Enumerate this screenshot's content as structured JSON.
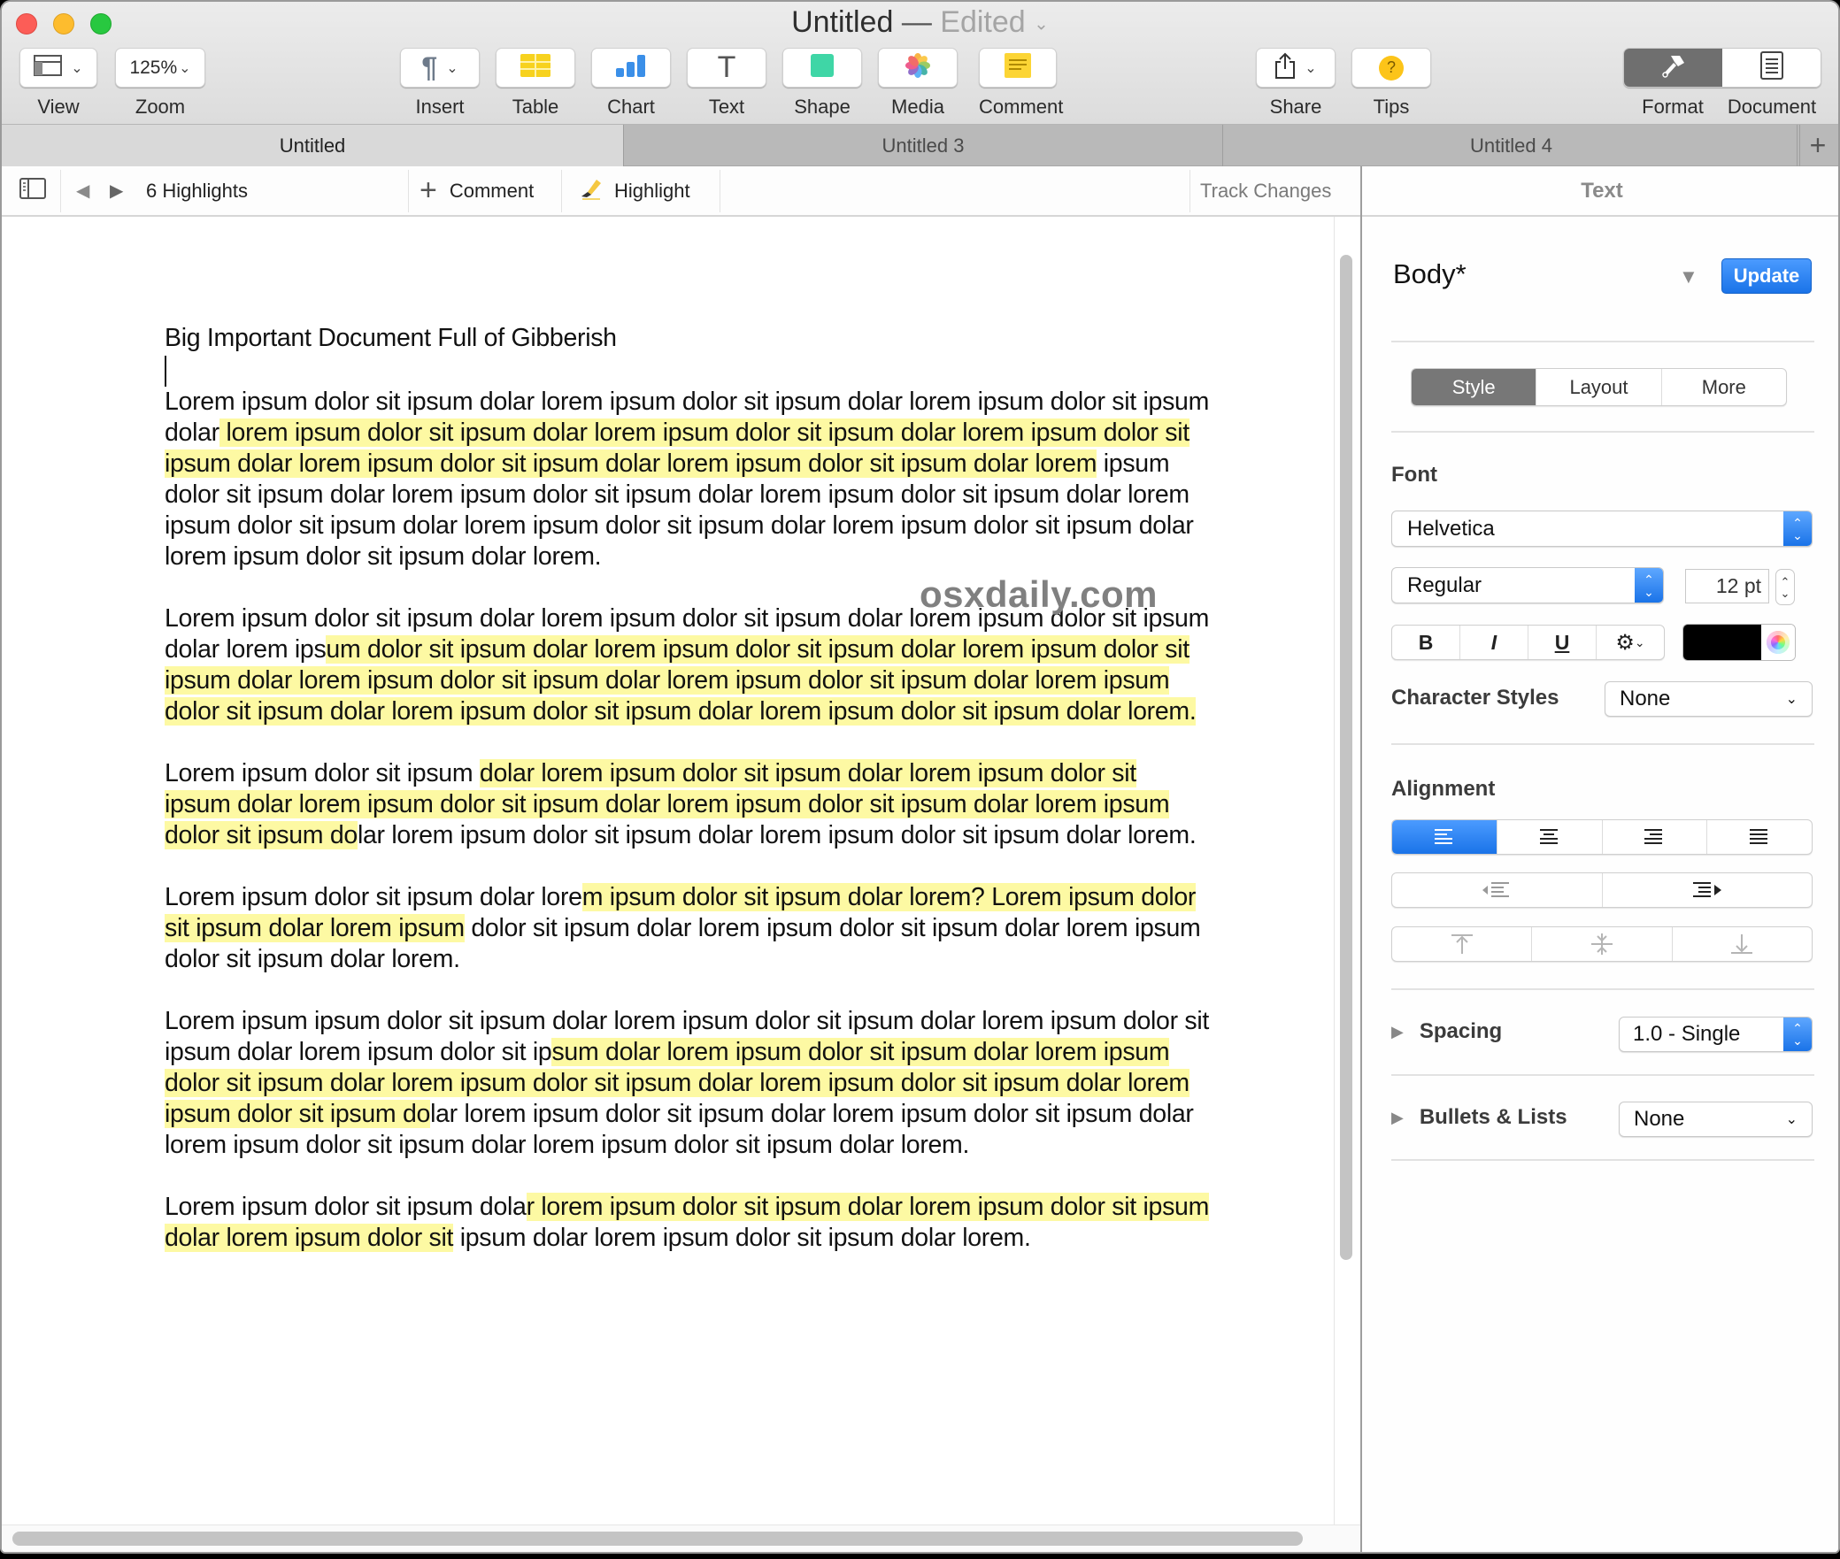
{
  "window": {
    "title": "Untitled",
    "title_separator": "—",
    "status": "Edited"
  },
  "toolbar": {
    "view": {
      "label": "View"
    },
    "zoom": {
      "label": "Zoom",
      "value": "125%"
    },
    "insert": {
      "label": "Insert",
      "glyph": "¶"
    },
    "table": {
      "label": "Table"
    },
    "chart": {
      "label": "Chart"
    },
    "text": {
      "label": "Text",
      "glyph": "T"
    },
    "shape": {
      "label": "Shape"
    },
    "media": {
      "label": "Media"
    },
    "comment": {
      "label": "Comment"
    },
    "share": {
      "label": "Share"
    },
    "tips": {
      "label": "Tips",
      "glyph": "?"
    },
    "format": {
      "label": "Format",
      "active": true
    },
    "document": {
      "label": "Document"
    }
  },
  "tabs": [
    {
      "label": "Untitled",
      "active": true
    },
    {
      "label": "Untitled 3",
      "active": false
    },
    {
      "label": "Untitled 4",
      "active": false
    }
  ],
  "tab_add_glyph": "+",
  "highlights_bar": {
    "count_label": "6 Highlights",
    "comment_label": "Comment",
    "highlight_label": "Highlight",
    "track_changes_label": "Track Changes"
  },
  "document": {
    "title": "Big Important Document Full of Gibberish",
    "watermark": "osxdaily.com",
    "highlight_color": "#fdf9a3",
    "paragraphs": [
      [
        {
          "text": "Lorem ipsum dolor sit ipsum dolar lorem ipsum dolor sit ipsum dolar lorem ipsum dolor sit ipsum dolar",
          "hl": false
        },
        {
          "text": " lorem ipsum dolor sit ipsum dolar lorem ipsum dolor sit ipsum dolar lorem ipsum dolor sit ipsum dolar lorem ipsum dolor sit ipsum dolar lorem ipsum dolor sit ipsum dolar lorem",
          "hl": true
        },
        {
          "text": " ipsum dolor sit ipsum dolar lorem ipsum dolor sit ipsum dolar lorem ipsum dolor sit ipsum dolar lorem ipsum dolor sit ipsum dolar lorem ipsum dolor sit ipsum dolar lorem ipsum dolor sit ipsum dolar lorem ipsum dolor sit ipsum dolar lorem.",
          "hl": false
        }
      ],
      [
        {
          "text": "Lorem ipsum dolor sit ipsum dolar lorem ipsum dolor sit ipsum dolar lorem ipsum dolor sit ipsum dolar lorem ips",
          "hl": false
        },
        {
          "text": "um dolor sit ipsum dolar lorem ipsum dolor sit ipsum dolar lorem ipsum dolor sit ipsum dolar lorem ipsum dolor sit ipsum dolar lorem ipsum dolor sit ipsum dolar lorem ipsum dolor sit ipsum dolar lorem ipsum dolor sit ipsum dolar lorem ipsum dolor sit ipsum dolar lorem. ",
          "hl": true
        }
      ],
      [
        {
          "text": "Lorem ipsum dolor sit ipsum ",
          "hl": false
        },
        {
          "text": "dolar lorem ipsum dolor sit ipsum dolar lorem ipsum dolor sit ipsum dolar lorem ipsum dolor sit ipsum dolar lorem ipsum dolor sit ipsum dolar lorem ipsum dolor sit ipsum do",
          "hl": true
        },
        {
          "text": "lar lorem ipsum dolor sit ipsum dolar lorem ipsum dolor sit ipsum dolar lorem.",
          "hl": false
        }
      ],
      [
        {
          "text": "Lorem ipsum dolor sit ipsum dolar lore",
          "hl": false
        },
        {
          "text": "m ipsum dolor sit ipsum dolar lorem? Lorem ipsum dolor sit ipsum dolar lorem ipsum",
          "hl": true
        },
        {
          "text": " dolor sit ipsum dolar lorem ipsum dolor sit ipsum dolar lorem ipsum dolor sit ipsum dolar lorem.",
          "hl": false
        }
      ],
      [
        {
          "text": "Lorem ipsum ipsum dolor sit ipsum dolar lorem ipsum dolor sit ipsum dolar lorem ipsum dolor sit ipsum dolar lorem ipsum dolor sit ip",
          "hl": false
        },
        {
          "text": "sum dolar lorem ipsum dolor sit ipsum dolar lorem ipsum dolor sit ipsum dolar lorem ipsum dolor sit ipsum dolar lorem ipsum dolor sit ipsum dolar lorem ipsum dolor sit ipsum do",
          "hl": true
        },
        {
          "text": "lar lorem ipsum dolor sit ipsum dolar lorem ipsum dolor sit ipsum dolar lorem ipsum dolor sit ipsum dolar lorem ipsum dolor sit ipsum dolar lorem.",
          "hl": false
        }
      ],
      [
        {
          "text": "Lorem ipsum dolor sit ipsum dola",
          "hl": false
        },
        {
          "text": "r lorem ipsum dolor sit ipsum dolar lorem ipsum dolor sit ipsum dolar lorem ipsum dolor sit",
          "hl": true
        },
        {
          "text": " ipsum dolar lorem ipsum dolor sit ipsum dolar lorem.",
          "hl": false
        }
      ]
    ]
  },
  "sidebar": {
    "header": "Text",
    "paragraph_style": "Body*",
    "update_label": "Update",
    "tabs": [
      {
        "label": "Style",
        "active": true
      },
      {
        "label": "Layout",
        "active": false
      },
      {
        "label": "More",
        "active": false
      }
    ],
    "font": {
      "section_label": "Font",
      "family": "Helvetica",
      "typeface": "Regular",
      "size": "12 pt",
      "bold_label": "B",
      "italic_label": "I",
      "underline_label": "U",
      "text_color": "#000000"
    },
    "character_styles": {
      "label": "Character Styles",
      "value": "None"
    },
    "alignment": {
      "section_label": "Alignment",
      "selected": "left",
      "options": [
        "left",
        "center",
        "right",
        "justify"
      ]
    },
    "spacing": {
      "label": "Spacing",
      "value": "1.0 - Single"
    },
    "bullets": {
      "label": "Bullets & Lists",
      "value": "None"
    }
  },
  "colors": {
    "accent_blue": "#1a73e8",
    "highlight_yellow": "#fdf9a3",
    "active_tab_gray": "#6f6f6f"
  }
}
